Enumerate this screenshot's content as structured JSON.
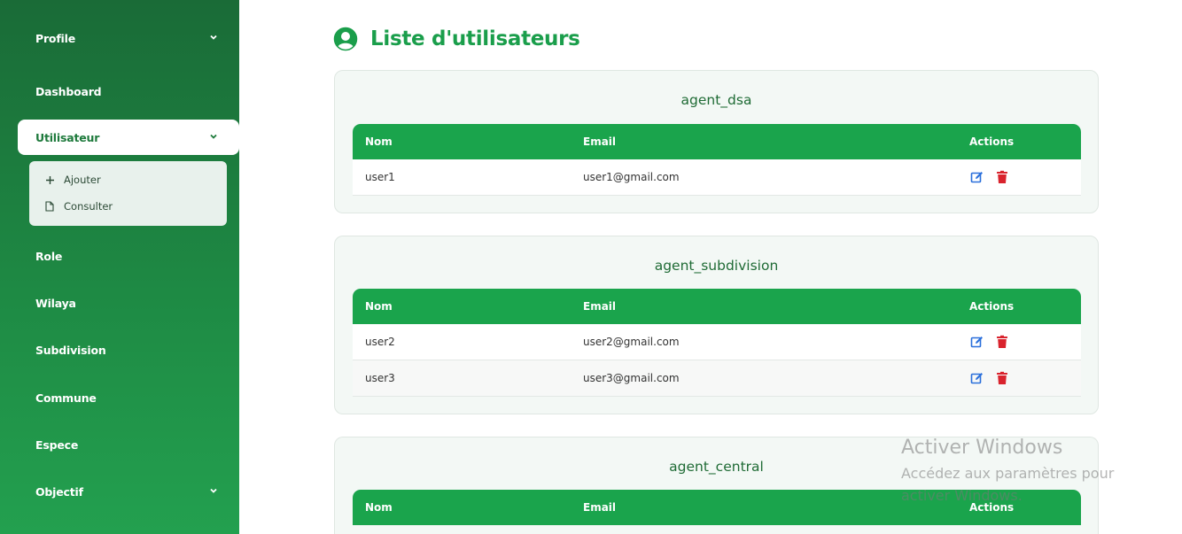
{
  "sidebar": {
    "items": [
      {
        "label": "Profile",
        "has_chevron": true
      },
      {
        "label": "Dashboard",
        "has_chevron": false
      },
      {
        "label": "Utilisateur",
        "has_chevron": true,
        "active": true
      },
      {
        "label": "Role",
        "has_chevron": false
      },
      {
        "label": "Wilaya",
        "has_chevron": false
      },
      {
        "label": "Subdivision",
        "has_chevron": false
      },
      {
        "label": "Commune",
        "has_chevron": false
      },
      {
        "label": "Espece",
        "has_chevron": false
      },
      {
        "label": "Objectif",
        "has_chevron": true
      }
    ],
    "submenu": [
      {
        "label": "Ajouter",
        "icon": "plus-icon"
      },
      {
        "label": "Consulter",
        "icon": "file-icon"
      }
    ]
  },
  "main": {
    "title": "Liste d'utilisateurs",
    "title_icon": "user-circle-icon",
    "columns": {
      "nom": "Nom",
      "email": "Email",
      "actions": "Actions"
    },
    "groups": [
      {
        "role": "agent_dsa",
        "rows": [
          {
            "nom": "user1",
            "email": "user1@gmail.com"
          }
        ]
      },
      {
        "role": "agent_subdivision",
        "rows": [
          {
            "nom": "user2",
            "email": "user2@gmail.com"
          },
          {
            "nom": "user3",
            "email": "user3@gmail.com"
          }
        ]
      },
      {
        "role": "agent_central",
        "rows": []
      }
    ],
    "row_actions": {
      "edit_icon": "edit-icon",
      "delete_icon": "trash-icon"
    }
  },
  "watermark": {
    "line1": "Activer Windows",
    "line2": "Accédez aux paramètres pour activer Windows."
  },
  "colors": {
    "accent": "#1aa44c",
    "title": "#1a9e4b",
    "edit": "#2a6fdb",
    "delete": "#d9232d"
  }
}
